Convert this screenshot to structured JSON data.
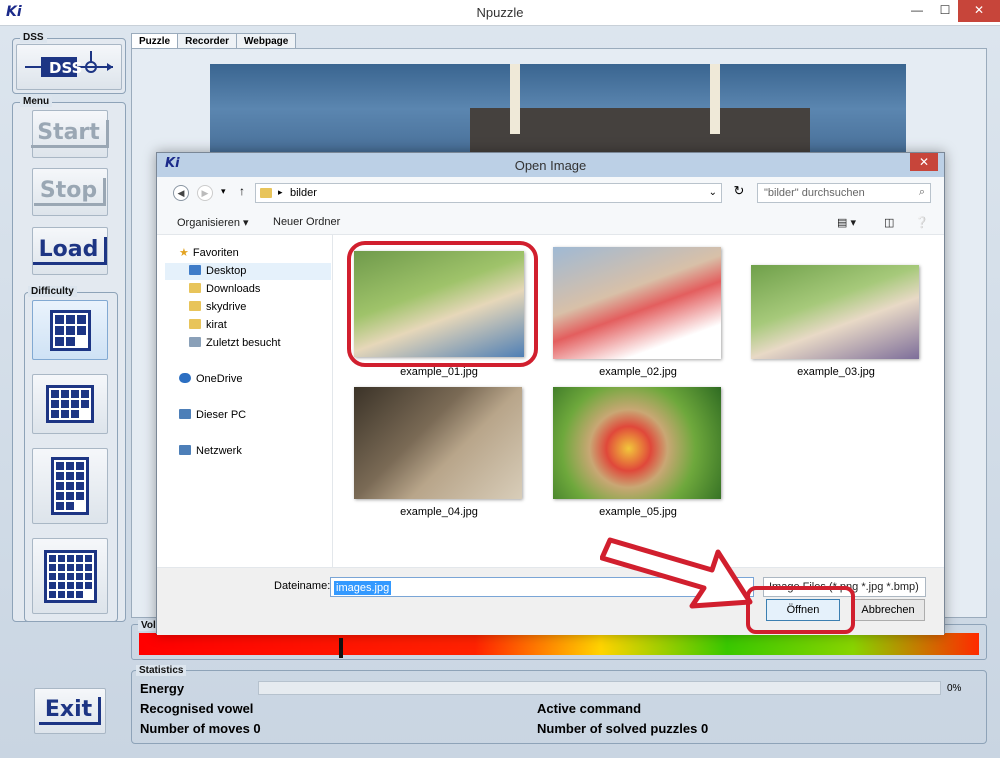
{
  "window": {
    "logo": "Ki",
    "title": "Npuzzle",
    "min": "—",
    "max": "☐",
    "close": "✕"
  },
  "left": {
    "dss_label": "DSS",
    "dss_text": "DSS",
    "menu_label": "Menu",
    "start": "Start",
    "stop": "Stop",
    "load": "Load",
    "difficulty_label": "Difficulty",
    "exit": "Exit"
  },
  "tabs": [
    "Puzzle",
    "Recorder",
    "Webpage"
  ],
  "volume": {
    "label": "Volu",
    "level": 0.24
  },
  "stats": {
    "label": "Statistics",
    "energy": "Energy",
    "energy_pct": "0%",
    "vowel": "Recognised vowel",
    "active": "Active command",
    "moves": "Number of moves  0",
    "solved": "Number of solved puzzles 0"
  },
  "dialog": {
    "logo": "Ki",
    "title": "Open Image",
    "close": "✕",
    "path": "bilder",
    "search_placeholder": "\"bilder\" durchsuchen",
    "organize": "Organisieren ▾",
    "new_folder": "Neuer Ordner",
    "nav": {
      "favorites": "Favoriten",
      "desktop": "Desktop",
      "downloads": "Downloads",
      "skydrive": "skydrive",
      "kirat": "kirat",
      "recent": "Zuletzt besucht",
      "onedrive": "OneDrive",
      "pc": "Dieser PC",
      "network": "Netzwerk"
    },
    "files": [
      "example_01.jpg",
      "example_02.jpg",
      "example_03.jpg",
      "example_04.jpg",
      "example_05.jpg"
    ],
    "filename_label": "Dateiname:",
    "filename_value": "images.jpg",
    "filter": "Image Files (*.png *.jpg *.bmp)",
    "open": "Öffnen",
    "cancel": "Abbrechen"
  },
  "colors": {
    "accent": "#1d3584",
    "highlight": "#d11f2e",
    "selection": "#3399ff"
  }
}
